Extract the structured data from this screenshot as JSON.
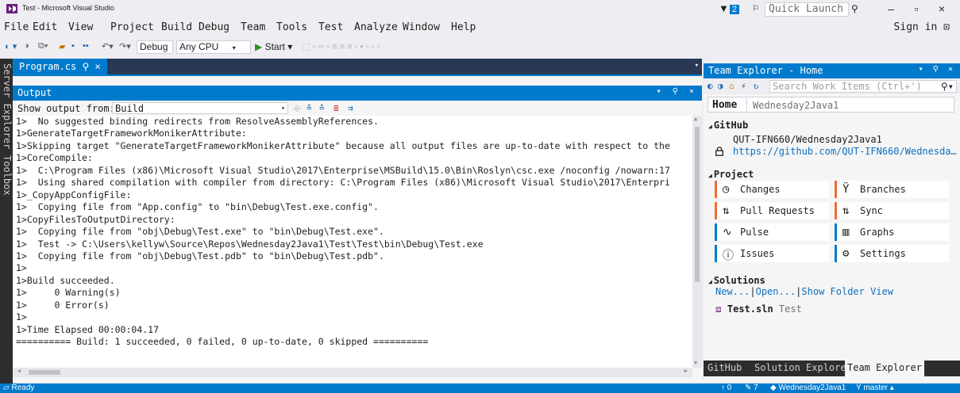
{
  "window": {
    "title": "Test - Microsoft Visual Studio",
    "notification_count": "2",
    "quick_launch_placeholder": "Quick Launch (Ctr",
    "sign_in": "Sign in"
  },
  "menu": [
    "File",
    "Edit",
    "View",
    "Project",
    "Build",
    "Debug",
    "Team",
    "Tools",
    "Test",
    "Analyze",
    "Window",
    "Help"
  ],
  "toolbar": {
    "configuration": "Debug",
    "platform": "Any CPU",
    "start_label": "Start"
  },
  "side_tabs": [
    "Server Explorer",
    "Toolbox"
  ],
  "document_tab": {
    "label": "Program.cs",
    "pin": "⚲ ×"
  },
  "output": {
    "title": "Output",
    "show_output_label": "Show output from:",
    "show_output_value": "Build",
    "lines": [
      "1>  No suggested binding redirects from ResolveAssemblyReferences.",
      "1>GenerateTargetFrameworkMonikerAttribute:",
      "1>Skipping target \"GenerateTargetFrameworkMonikerAttribute\" because all output files are up-to-date with respect to the",
      "1>CoreCompile:",
      "1>  C:\\Program Files (x86)\\Microsoft Visual Studio\\2017\\Enterprise\\MSBuild\\15.0\\Bin\\Roslyn\\csc.exe /noconfig /nowarn:17",
      "1>  Using shared compilation with compiler from directory: C:\\Program Files (x86)\\Microsoft Visual Studio\\2017\\Enterpri",
      "1>_CopyAppConfigFile:",
      "1>  Copying file from \"App.config\" to \"bin\\Debug\\Test.exe.config\".",
      "1>CopyFilesToOutputDirectory:",
      "1>  Copying file from \"obj\\Debug\\Test.exe\" to \"bin\\Debug\\Test.exe\".",
      "1>  Test -> C:\\Users\\kellyw\\Source\\Repos\\Wednesday2Java1\\Test\\Test\\bin\\Debug\\Test.exe",
      "1>  Copying file from \"obj\\Debug\\Test.pdb\" to \"bin\\Debug\\Test.pdb\".",
      "1>",
      "1>Build succeeded.",
      "1>     0 Warning(s)",
      "1>     0 Error(s)",
      "1>",
      "1>Time Elapsed 00:00:04.17",
      "========== Build: 1 succeeded, 0 failed, 0 up-to-date, 0 skipped =========="
    ]
  },
  "team_explorer": {
    "title": "Team Explorer - Home",
    "search_placeholder": "Search Work Items (Ctrl+')",
    "home_label": "Home",
    "repo_name": "Wednesday2Java1",
    "github_section": "GitHub",
    "github_repo": "QUT-IFN660/Wednesday2Java1",
    "github_url": "https://github.com/QUT-IFN660/Wednesda…",
    "project_section": "Project",
    "tiles": [
      {
        "label": "Changes",
        "icon": "clock-icon",
        "glyph": "◷"
      },
      {
        "label": "Branches",
        "icon": "branch-icon",
        "glyph": "Ÿ"
      },
      {
        "label": "Pull Requests",
        "icon": "pull-request-icon",
        "glyph": "⇅"
      },
      {
        "label": "Sync",
        "icon": "sync-icon",
        "glyph": "⇅"
      },
      {
        "label": "Pulse",
        "icon": "pulse-icon",
        "glyph": "∿"
      },
      {
        "label": "Graphs",
        "icon": "graph-icon",
        "glyph": "▥"
      },
      {
        "label": "Issues",
        "icon": "issue-icon",
        "glyph": "ⓘ"
      },
      {
        "label": "Settings",
        "icon": "gear-icon",
        "glyph": "⚙"
      }
    ],
    "solutions_section": "Solutions",
    "solution_links": [
      "New...",
      "Open...",
      "Show Folder View"
    ],
    "solution_file": "Test.sln",
    "solution_file_sub": "Test",
    "bottom_tabs": [
      "GitHub",
      "Solution Explorer",
      "Team Explorer"
    ]
  },
  "status": {
    "left": "Ready",
    "up": "0",
    "edits": "7",
    "repo": "Wednesday2Java1",
    "branch": "master"
  },
  "colors": {
    "accent": "#007acc",
    "chrome": "#eeeef2",
    "dark_strip": "#2d2d30",
    "link": "#0e70c0"
  }
}
